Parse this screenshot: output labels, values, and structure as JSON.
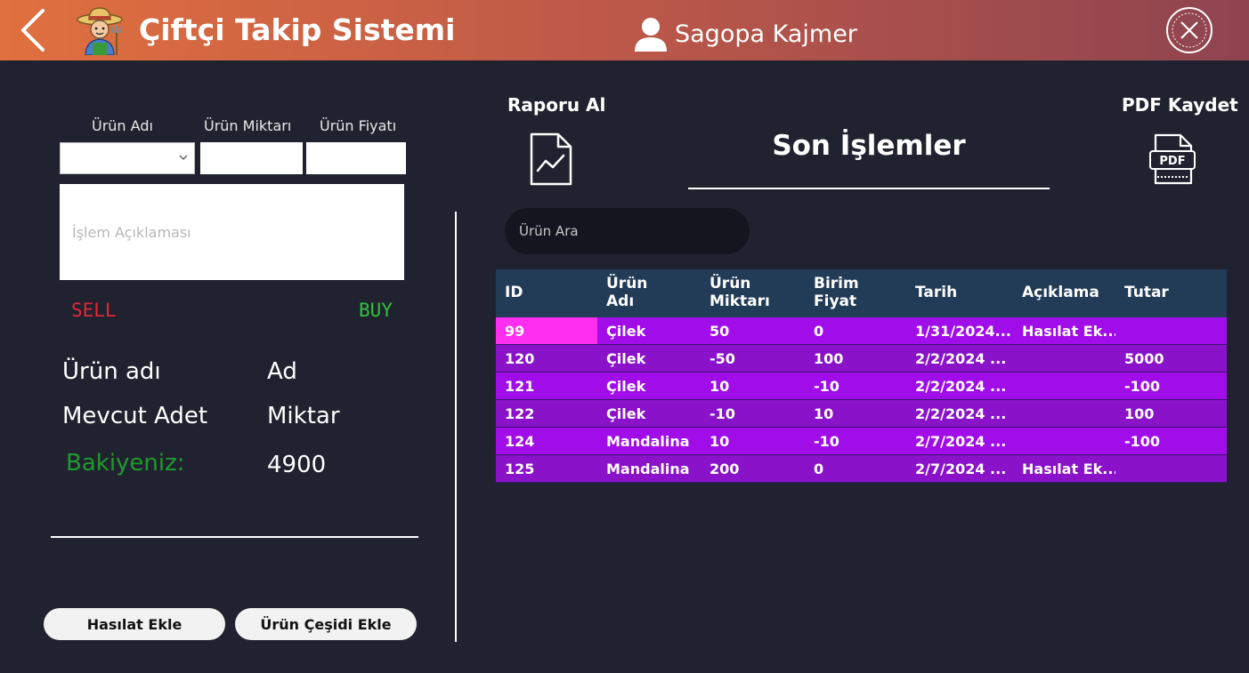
{
  "header": {
    "title": "Çiftçi Takip Sistemi",
    "user_name": "Sagopa Kajmer"
  },
  "form": {
    "label_product_name": "Ürün Adı",
    "label_product_qty": "Ürün Miktarı",
    "label_product_price": "Ürün Fiyatı",
    "description_placeholder": "İşlem Açıklaması",
    "sell_label": "SELL",
    "buy_label": "BUY"
  },
  "info": {
    "product_name_label": "Ürün adı",
    "product_name_value": "Ad",
    "stock_label": "Mevcut Adet",
    "stock_value": "Miktar",
    "balance_label": "Bakiyeniz:",
    "balance_value": "4900"
  },
  "buttons": {
    "add_harvest": "Hasılat Ekle",
    "add_product_type": "Ürün Çeşidi Ekle"
  },
  "report": {
    "get_report_label": "Raporu Al",
    "section_title": "Son İşlemler",
    "save_pdf_label": "PDF Kaydet",
    "pdf_text": "PDF"
  },
  "search": {
    "placeholder": "Ürün Ara"
  },
  "table": {
    "columns": [
      "ID",
      "Ürün\nAdı",
      "Ürün\nMiktarı",
      "Birim\nFiyat",
      "Tarih",
      "Açıklama",
      "Tutar"
    ],
    "rows": [
      [
        "99",
        "Çilek",
        "50",
        "0",
        "1/31/2024...",
        "Hasılat Ek...",
        ""
      ],
      [
        "120",
        "Çilek",
        "-50",
        "100",
        "2/2/2024 ...",
        "",
        "5000"
      ],
      [
        "121",
        "Çilek",
        "10",
        "-10",
        "2/2/2024 ...",
        "",
        "-100"
      ],
      [
        "122",
        "Çilek",
        "-10",
        "10",
        "2/2/2024 ...",
        "",
        "100"
      ],
      [
        "124",
        "Mandalina",
        "10",
        "-10",
        "2/7/2024 ...",
        "",
        "-100"
      ],
      [
        "125",
        "Mandalina",
        "200",
        "0",
        "2/7/2024 ...",
        "Hasılat Ek...",
        ""
      ]
    ]
  },
  "colors": {
    "header_start": "#e0703e",
    "header_end": "#8e4450",
    "background": "#20232f",
    "table_header": "#223b57",
    "row_a": "#a10de8",
    "row_b": "#8a12c9",
    "selected_cell": "#ff2ef0",
    "sell": "#e0283a",
    "buy": "#2fc23a",
    "balance": "#1f9a2c"
  }
}
